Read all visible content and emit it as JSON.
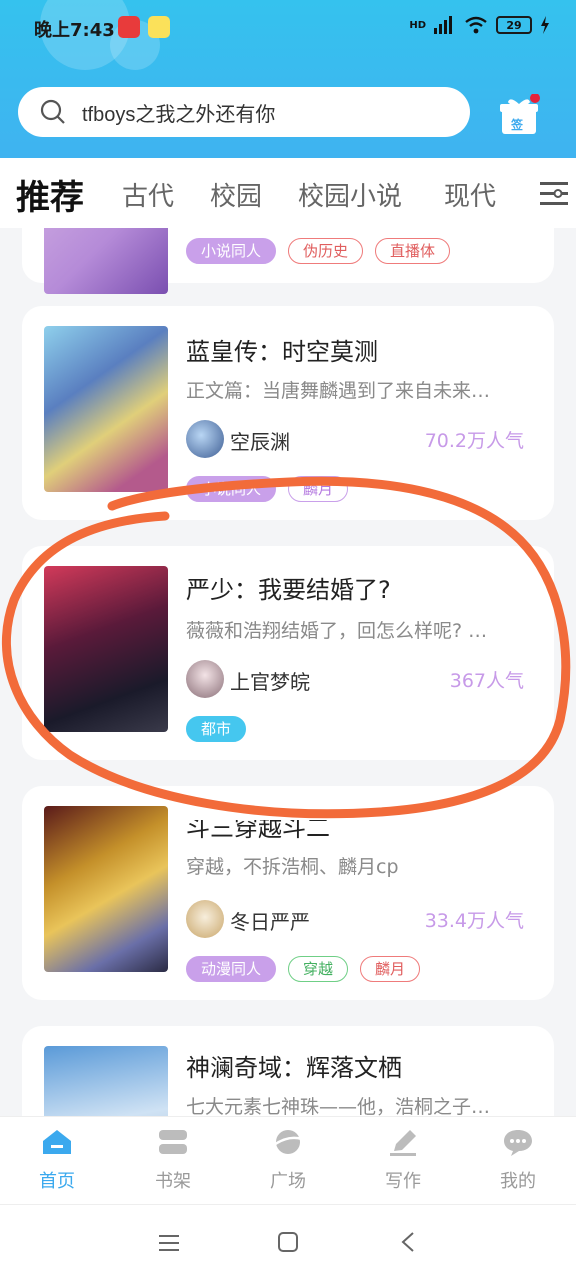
{
  "status_bar": {
    "time": "晚上7:43",
    "battery": "29",
    "network": "HD"
  },
  "search": {
    "query": "tfboys之我之外还有你"
  },
  "gift": {
    "badge_text": "签"
  },
  "category_tabs": [
    "推荐",
    "古代",
    "校园",
    "校园小说",
    "现代"
  ],
  "books": [
    {
      "title": "",
      "description": "",
      "author": "",
      "popularity": "",
      "tags": [
        {
          "label": "小说同人",
          "style": "purple"
        },
        {
          "label": "伪历史",
          "style": "red"
        },
        {
          "label": "直播体",
          "style": "red"
        }
      ]
    },
    {
      "title": "蓝皇传：时空莫测",
      "description": "正文篇：当唐舞麟遇到了来自未来…",
      "author": "空辰渊",
      "popularity": "70.2万人气",
      "tags": [
        {
          "label": "小说同人",
          "style": "purple"
        },
        {
          "label": "麟月",
          "style": "lav"
        }
      ]
    },
    {
      "title": "严少：我要结婚了?",
      "description": "薇薇和浩翔结婚了，回怎么样呢? …",
      "author": "上官梦皖",
      "popularity": "367人气",
      "tags": [
        {
          "label": "都市",
          "style": "cyan"
        }
      ]
    },
    {
      "title": "斗三穿越斗二",
      "description": "穿越，不拆浩桐、麟月cp",
      "author": "冬日严严",
      "popularity": "33.4万人气",
      "tags": [
        {
          "label": "动漫同人",
          "style": "purple"
        },
        {
          "label": "穿越",
          "style": "green"
        },
        {
          "label": "麟月",
          "style": "red"
        }
      ]
    },
    {
      "title": "神澜奇域：辉落文栖",
      "description": "七大元素七神珠——他，浩桐之子…",
      "author": "",
      "popularity": "",
      "tags": []
    }
  ],
  "bottom_nav": [
    {
      "label": "首页",
      "icon": "home-icon",
      "active": true
    },
    {
      "label": "书架",
      "icon": "bookshelf-icon",
      "active": false
    },
    {
      "label": "广场",
      "icon": "plaza-icon",
      "active": false
    },
    {
      "label": "写作",
      "icon": "pen-icon",
      "active": false
    },
    {
      "label": "我的",
      "icon": "chat-profile-icon",
      "active": false
    }
  ],
  "colors": {
    "header": "#35c2ee",
    "accent": "#3ba9ee",
    "popularity": "#c79ae8",
    "annotation": "#f26b3a"
  }
}
